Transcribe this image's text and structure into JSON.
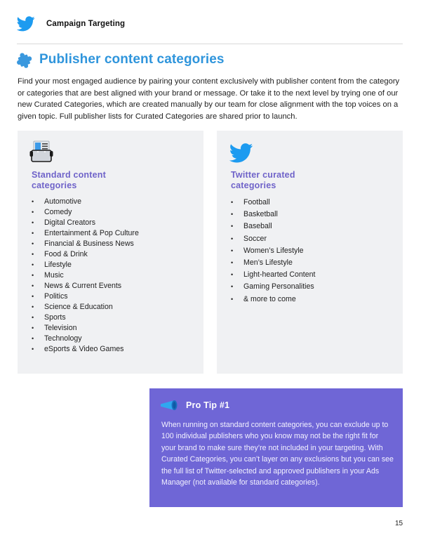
{
  "header": {
    "title": "Campaign Targeting",
    "logo_icon": "twitter-bird-icon"
  },
  "section": {
    "title": "Publisher content categories",
    "icon": "puzzle-piece-icon",
    "intro": "Find your most engaged audience by pairing your content exclusively with publisher content from the category or categories that are best aligned with your brand or message. Or take it to the next level by trying one of our new Curated Categories, which are created manually by our team for close alignment with the top voices on a given topic. Full publisher lists for Curated Categories are shared prior to launch."
  },
  "standard": {
    "icon": "rolodex-icon",
    "title_line1": "Standard content",
    "title_line2": "categories",
    "items": [
      "Automotive",
      "Comedy",
      "Digital Creators",
      "Entertainment & Pop Culture",
      "Financial & Business News",
      "Food & Drink",
      "Lifestyle",
      "Music",
      "News & Current Events",
      "Politics",
      "Science & Education",
      "Sports",
      "Television",
      "Technology",
      "eSports & Video Games"
    ]
  },
  "curated": {
    "icon": "twitter-bird-icon",
    "title_line1": "Twitter curated",
    "title_line2": "categories",
    "items": [
      "Football",
      "Basketball",
      "Baseball",
      "Soccer",
      "Women’s Lifestyle",
      "Men’s Lifestyle",
      "Light-hearted Content",
      "Gaming Personalities",
      "& more to come"
    ]
  },
  "protip": {
    "icon": "megaphone-icon",
    "title": "Pro Tip #1",
    "body": "When running on standard content categories, you can exclude up to 100 individual publishers who you know may not be the right fit for your brand to make sure they’re not included in your targeting. With Curated Categories, you can’t layer on any exclusions but you can see the full list of Twitter-selected and approved publishers in your Ads Manager (not available for standard categories)."
  },
  "bullet": "•",
  "page_number": "15",
  "colors": {
    "twitter_blue": "#1d9bf0",
    "title_blue": "#2f95dc",
    "purple_heading": "#6f63c9",
    "protip_bg": "#6f66d6",
    "panel_bg": "#f0f1f3"
  }
}
